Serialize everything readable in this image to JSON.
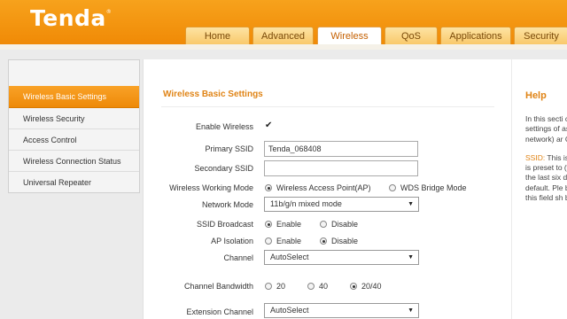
{
  "brand": {
    "logo_text": "Tenda",
    "logo_mark": "®"
  },
  "nav": {
    "tabs": [
      "Home",
      "Advanced",
      "Wireless",
      "QoS",
      "Applications",
      "Security"
    ],
    "active": "Wireless"
  },
  "sidebar": {
    "items": [
      {
        "label": "Wireless Basic Settings",
        "active": true
      },
      {
        "label": "Wireless Security",
        "active": false
      },
      {
        "label": "Access Control",
        "active": false
      },
      {
        "label": "Wireless Connection Status",
        "active": false
      },
      {
        "label": "Universal Repeater",
        "active": false
      }
    ]
  },
  "form": {
    "section_title": "Wireless Basic Settings",
    "enable_wireless": {
      "label": "Enable Wireless",
      "checked": true,
      "mark": "✔"
    },
    "primary_ssid": {
      "label": "Primary SSID",
      "value": "Tenda_068408"
    },
    "secondary_ssid": {
      "label": "Secondary SSID",
      "value": ""
    },
    "working_mode": {
      "label": "Wireless Working Mode",
      "options": [
        "Wireless Access Point(AP)",
        "WDS Bridge Mode"
      ],
      "selected": "Wireless Access Point(AP)"
    },
    "network_mode": {
      "label": "Network Mode",
      "value": "11b/g/n mixed mode"
    },
    "ssid_broadcast": {
      "label": "SSID Broadcast",
      "options": [
        "Enable",
        "Disable"
      ],
      "selected": "Enable"
    },
    "ap_isolation": {
      "label": "AP Isolation",
      "options": [
        "Enable",
        "Disable"
      ],
      "selected": "Disable"
    },
    "channel": {
      "label": "Channel",
      "value": "AutoSelect"
    },
    "channel_bandwidth": {
      "label": "Channel Bandwidth",
      "options": [
        "20",
        "40",
        "20/40"
      ],
      "selected": "20/40"
    },
    "extension_channel": {
      "label": "Extension Channel",
      "value": "AutoSelect"
    },
    "dropdown_arrow": "▼"
  },
  "help": {
    "title": "Help",
    "paragraph1": "In this secti configure th settings of as the SSID network) ar Channel.",
    "ssid_term": "SSID:",
    "paragraph2": " This is of your wire is preset to (where \"XX) the last six device MAC default. Ple better secu this field sh blank."
  },
  "colors": {
    "accent": "#f08a06",
    "heading": "#e08416",
    "tab_active_text": "#c45f00"
  }
}
